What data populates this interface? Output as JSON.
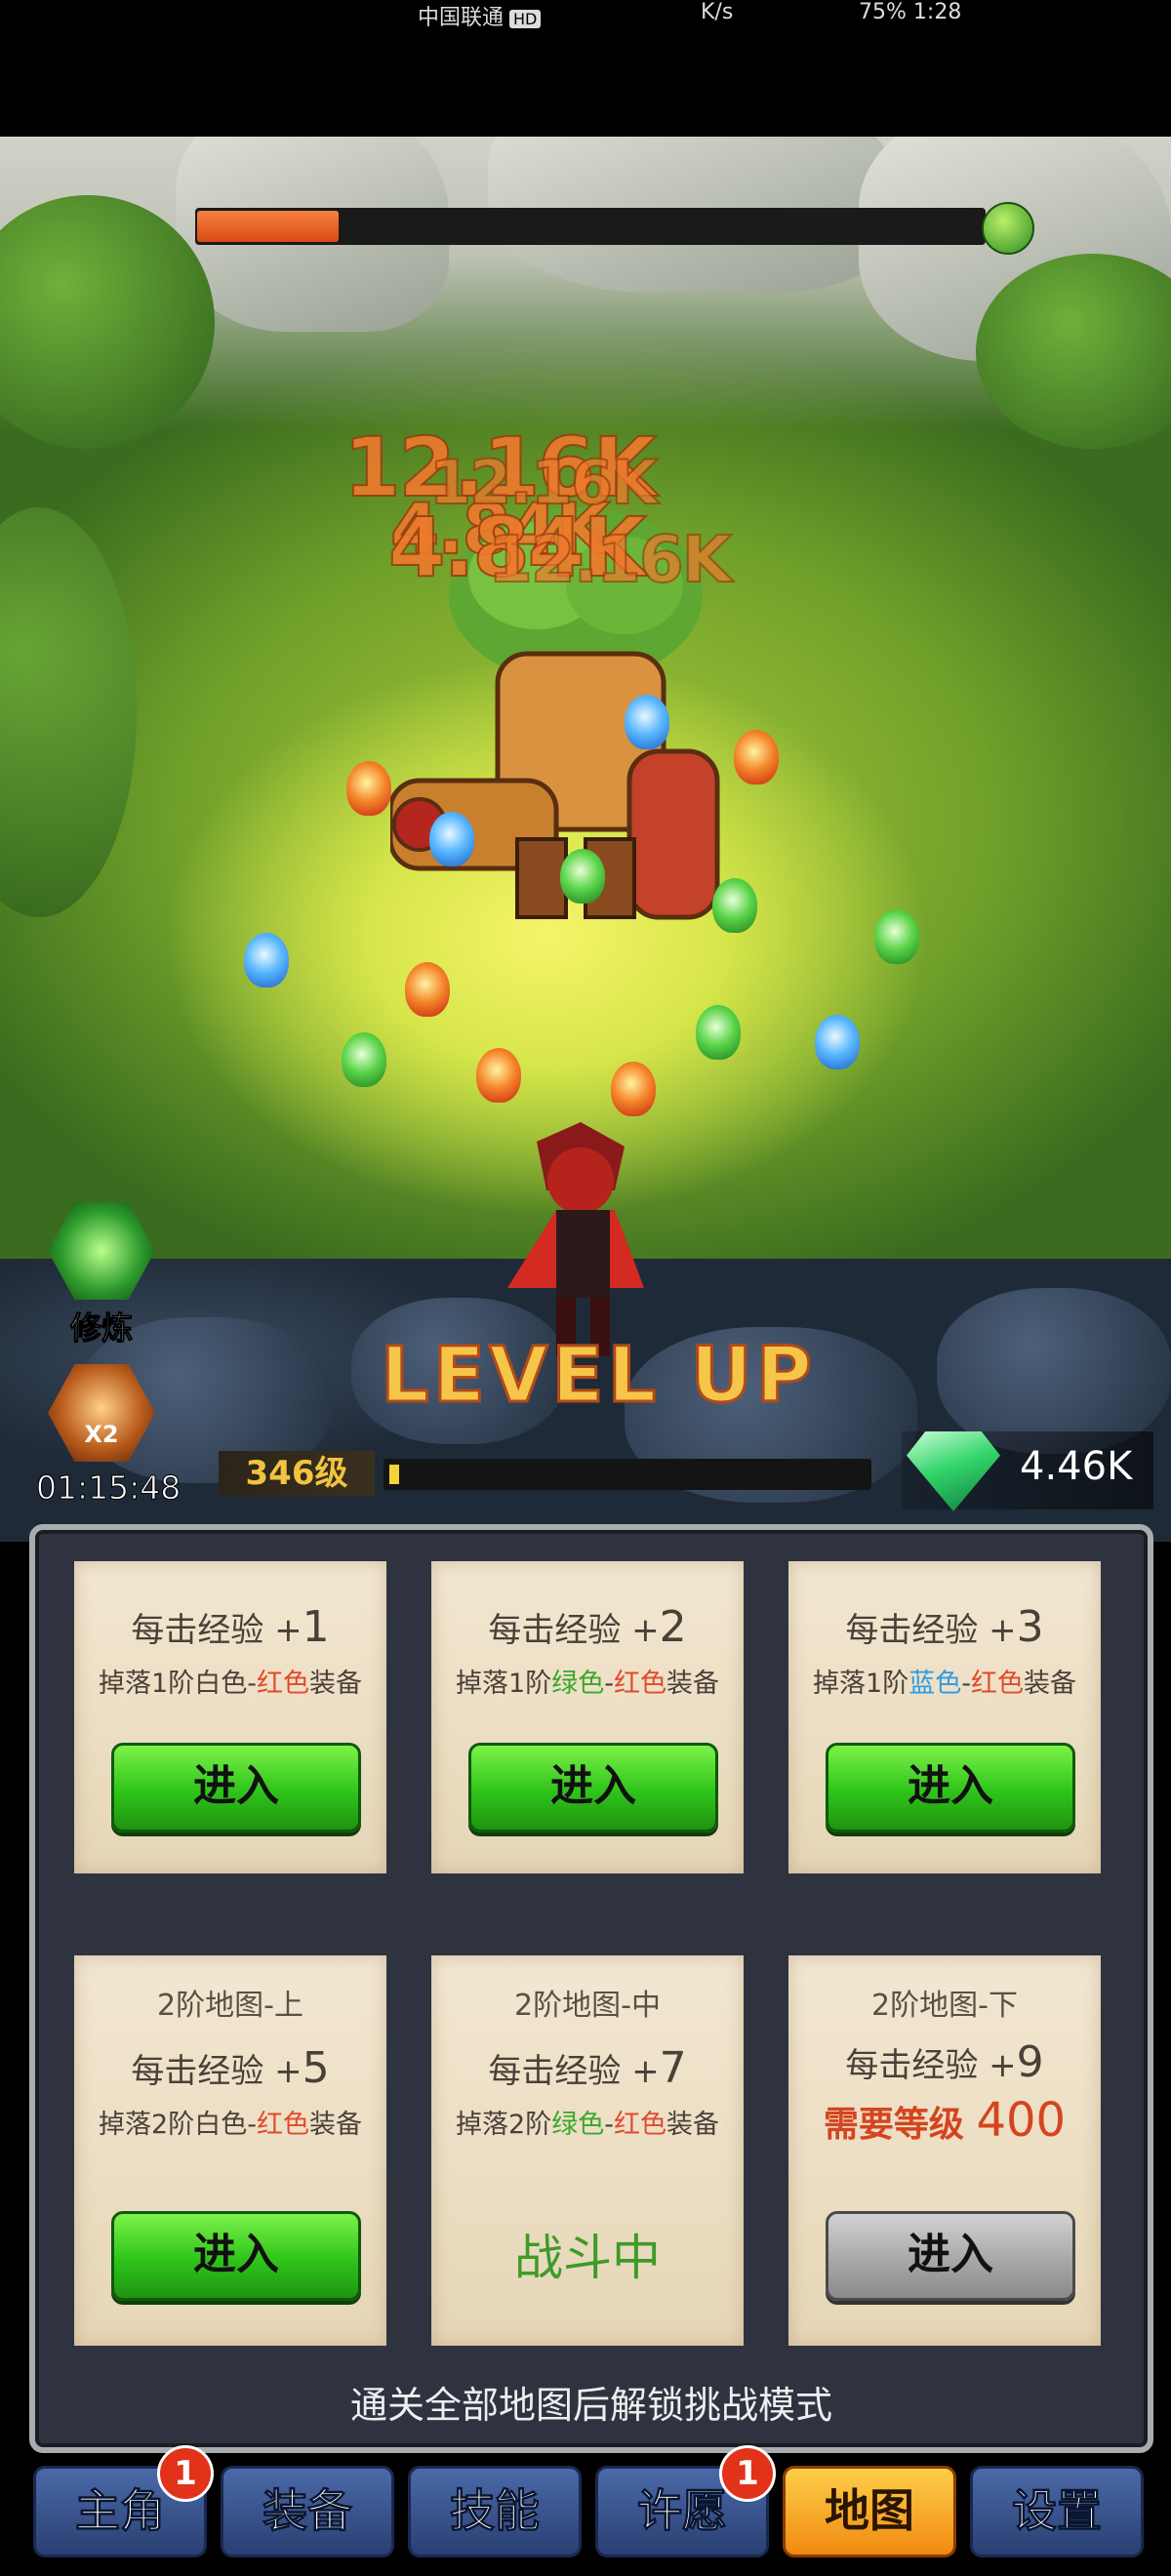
{
  "status_bar": {
    "carrier": "中国联通",
    "hd": "HD",
    "net_speed": "K/s",
    "battery": "75%",
    "time": "1:28"
  },
  "boss": {
    "hp_fraction": 0.18
  },
  "damage_numbers": [
    "12.16K",
    "4.84K",
    "12.16K",
    "4.84K",
    "12.16K"
  ],
  "level_up_text": "LEVEL UP",
  "side_buttons": {
    "train_label": "修炼",
    "x2_badge": "X2",
    "timer": "01:15:48"
  },
  "player": {
    "level": "346级",
    "exp_fraction": 0.02
  },
  "currency": {
    "diamonds": "4.46K"
  },
  "maps": [
    {
      "title": "",
      "exp_label": "每击经验 +",
      "exp_value": "1",
      "drop_prefix": "掉落1阶",
      "drop_color1": "白色",
      "drop_sep": "-",
      "drop_color2": "红色",
      "drop_suffix": "装备",
      "action": "进入",
      "state": "enter"
    },
    {
      "title": "",
      "exp_label": "每击经验 +",
      "exp_value": "2",
      "drop_prefix": "掉落1阶",
      "drop_color1": "绿色",
      "drop_sep": "-",
      "drop_color2": "红色",
      "drop_suffix": "装备",
      "action": "进入",
      "state": "enter"
    },
    {
      "title": "",
      "exp_label": "每击经验 +",
      "exp_value": "3",
      "drop_prefix": "掉落1阶",
      "drop_color1": "蓝色",
      "drop_sep": "-",
      "drop_color2": "红色",
      "drop_suffix": "装备",
      "action": "进入",
      "state": "enter"
    },
    {
      "title": "2阶地图-上",
      "exp_label": "每击经验 +",
      "exp_value": "5",
      "drop_prefix": "掉落2阶",
      "drop_color1": "白色",
      "drop_sep": "-",
      "drop_color2": "红色",
      "drop_suffix": "装备",
      "action": "进入",
      "state": "enter"
    },
    {
      "title": "2阶地图-中",
      "exp_label": "每击经验 +",
      "exp_value": "7",
      "drop_prefix": "掉落2阶",
      "drop_color1": "绿色",
      "drop_sep": "-",
      "drop_color2": "红色",
      "drop_suffix": "装备",
      "action": "战斗中",
      "state": "fighting"
    },
    {
      "title": "2阶地图-下",
      "exp_label": "每击经验 +",
      "exp_value": "9",
      "need_label": "需要等级",
      "need_value": "400",
      "action": "进入",
      "state": "locked"
    }
  ],
  "panel_note": "通关全部地图后解锁挑战模式",
  "bottom_nav": [
    {
      "label": "主角",
      "badge": "1"
    },
    {
      "label": "装备",
      "badge": ""
    },
    {
      "label": "技能",
      "badge": ""
    },
    {
      "label": "许愿",
      "badge": "1"
    },
    {
      "label": "地图",
      "badge": "",
      "active": true
    },
    {
      "label": "设置",
      "badge": ""
    }
  ],
  "colors": {
    "accent_green": "#2fc41a",
    "accent_orange": "#f08a10",
    "red_text": "#e04a2a"
  }
}
